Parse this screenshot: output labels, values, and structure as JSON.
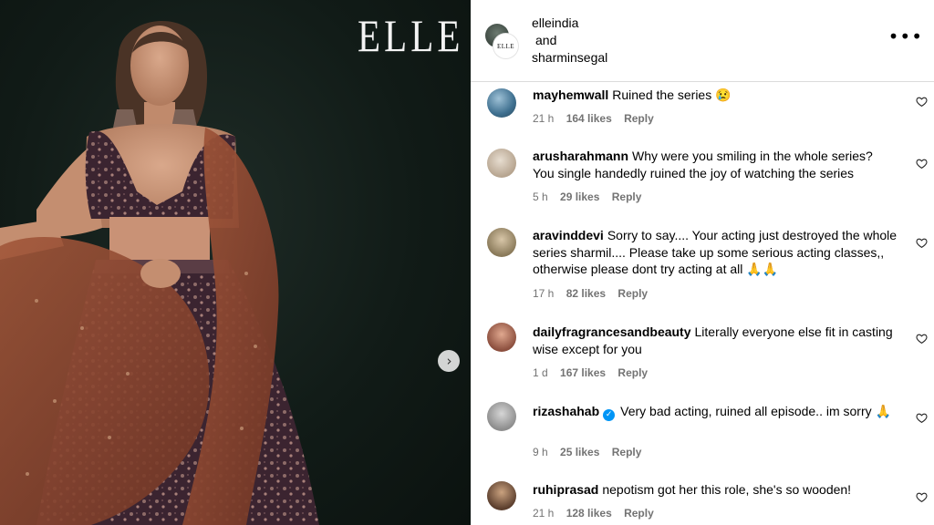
{
  "post": {
    "magazine_logo": "ELLE",
    "next_icon": "chevron-right-icon"
  },
  "header": {
    "avatar_logo": "ELLE",
    "author_1": "elleindia",
    "and_label": "and",
    "author_2": "sharminsegal",
    "more_icon": "more-options-icon",
    "more_label": "•••"
  },
  "comments": [
    {
      "user": "mayhemwall",
      "text": "Ruined the series 😢",
      "time": "21 h",
      "likes": "164 likes",
      "reply": "Reply",
      "verified": false
    },
    {
      "user": "arusharahmann",
      "text": "Why were you smiling in the whole series? You single handedly ruined the joy of watching the series",
      "time": "5 h",
      "likes": "29 likes",
      "reply": "Reply",
      "verified": false
    },
    {
      "user": "aravinddevi",
      "text": "Sorry to say.... Your acting just destroyed the whole series sharmil.... Please take up some serious acting classes,, otherwise please dont try acting at all 🙏🙏",
      "time": "17 h",
      "likes": "82 likes",
      "reply": "Reply",
      "verified": false
    },
    {
      "user": "dailyfragrancesandbeauty",
      "text": "Literally everyone else fit in casting wise except for you",
      "time": "1 d",
      "likes": "167 likes",
      "reply": "Reply",
      "verified": false
    },
    {
      "user": "rizashahab",
      "text": "Very bad acting, ruined all episode.. im sorry 🙏",
      "time": "9 h",
      "likes": "25 likes",
      "reply": "Reply",
      "verified": true
    },
    {
      "user": "ruhiprasad",
      "text": "nepotism got her this role, she's so wooden!",
      "time": "21 h",
      "likes": "128 likes",
      "reply": "Reply",
      "verified": false
    }
  ],
  "colors": {
    "photo_bg": "#111b17",
    "meta_text": "#737373",
    "divider": "#dbdbdb",
    "verified_blue": "#0095f6"
  }
}
